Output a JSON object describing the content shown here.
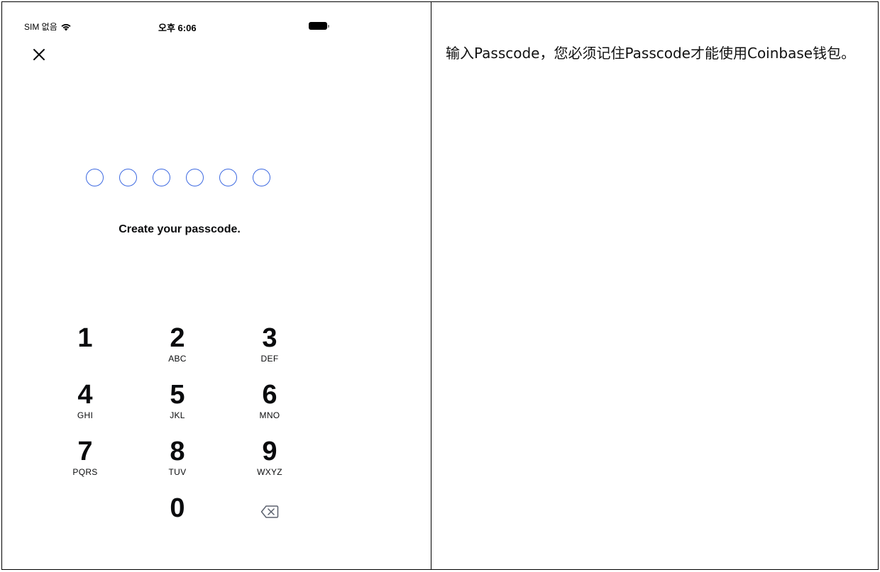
{
  "status_bar": {
    "carrier": "SIM 없음",
    "wifi_icon": "wifi-icon",
    "time": "오후 6:06",
    "battery_icon": "battery-icon"
  },
  "header": {
    "close_icon": "close-icon"
  },
  "passcode": {
    "digit_count": 6,
    "filled": 0,
    "dot_color": "#3e6ae1",
    "prompt": "Create your passcode."
  },
  "keypad": {
    "keys": [
      {
        "digit": "1",
        "letters": ""
      },
      {
        "digit": "2",
        "letters": "ABC"
      },
      {
        "digit": "3",
        "letters": "DEF"
      },
      {
        "digit": "4",
        "letters": "GHI"
      },
      {
        "digit": "5",
        "letters": "JKL"
      },
      {
        "digit": "6",
        "letters": "MNO"
      },
      {
        "digit": "7",
        "letters": "PQRS"
      },
      {
        "digit": "8",
        "letters": "TUV"
      },
      {
        "digit": "9",
        "letters": "WXYZ"
      },
      {
        "digit": "0",
        "letters": ""
      }
    ],
    "backspace_icon": "backspace-icon"
  },
  "note": {
    "text": "输入Passcode，您必须记住Passcode才能使用Coinbase钱包。"
  }
}
